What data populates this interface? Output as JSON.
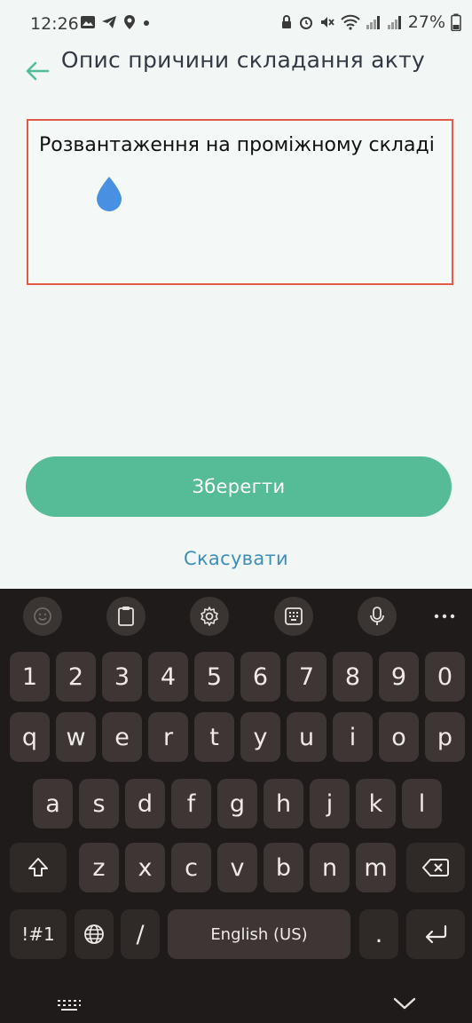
{
  "status_bar": {
    "time": "12:26",
    "battery": "27%"
  },
  "header": {
    "title": "Опис причини складання акту"
  },
  "reason_field": {
    "value": "Розвантаження на проміжному складі"
  },
  "actions": {
    "save_label": "Зберегти",
    "cancel_label": "Скасувати"
  },
  "keyboard": {
    "number_row": [
      "1",
      "2",
      "3",
      "4",
      "5",
      "6",
      "7",
      "8",
      "9",
      "0"
    ],
    "row1": [
      "q",
      "w",
      "e",
      "r",
      "t",
      "y",
      "u",
      "i",
      "o",
      "p"
    ],
    "row2": [
      "a",
      "s",
      "d",
      "f",
      "g",
      "h",
      "j",
      "k",
      "l"
    ],
    "row3": [
      "z",
      "x",
      "c",
      "v",
      "b",
      "n",
      "m"
    ],
    "symbols_label": "!#1",
    "slash_label": "/",
    "space_label": "English (US)",
    "period_label": "."
  },
  "colors": {
    "accent": "#55bc97",
    "link": "#3d8fba",
    "error_border": "#e25a4a",
    "keyboard_bg": "#1e1b1a"
  }
}
